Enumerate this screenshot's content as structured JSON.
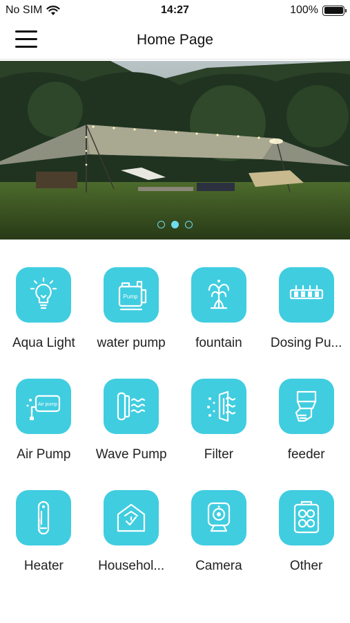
{
  "status": {
    "carrier": "No SIM",
    "time": "14:27",
    "battery": "100%",
    "battery_level": 1.0
  },
  "nav": {
    "title": "Home Page"
  },
  "banner": {
    "slide_count": 3,
    "active_slide": 1
  },
  "devices": [
    {
      "label": "Aqua Light",
      "icon": "bulb-icon"
    },
    {
      "label": "water pump",
      "icon": "water-pump-icon"
    },
    {
      "label": "fountain",
      "icon": "fountain-icon"
    },
    {
      "label": "Dosing Pu...",
      "icon": "dosing-pump-icon"
    },
    {
      "label": "Air Pump",
      "icon": "air-pump-icon"
    },
    {
      "label": "Wave Pump",
      "icon": "wave-pump-icon"
    },
    {
      "label": "Filter",
      "icon": "filter-icon"
    },
    {
      "label": "feeder",
      "icon": "feeder-icon"
    },
    {
      "label": "Heater",
      "icon": "heater-icon"
    },
    {
      "label": "Househol...",
      "icon": "household-icon"
    },
    {
      "label": "Camera",
      "icon": "camera-icon"
    },
    {
      "label": "Other",
      "icon": "other-icon"
    }
  ],
  "colors": {
    "tile": "#40cde0",
    "dot": "#6fdcec"
  }
}
